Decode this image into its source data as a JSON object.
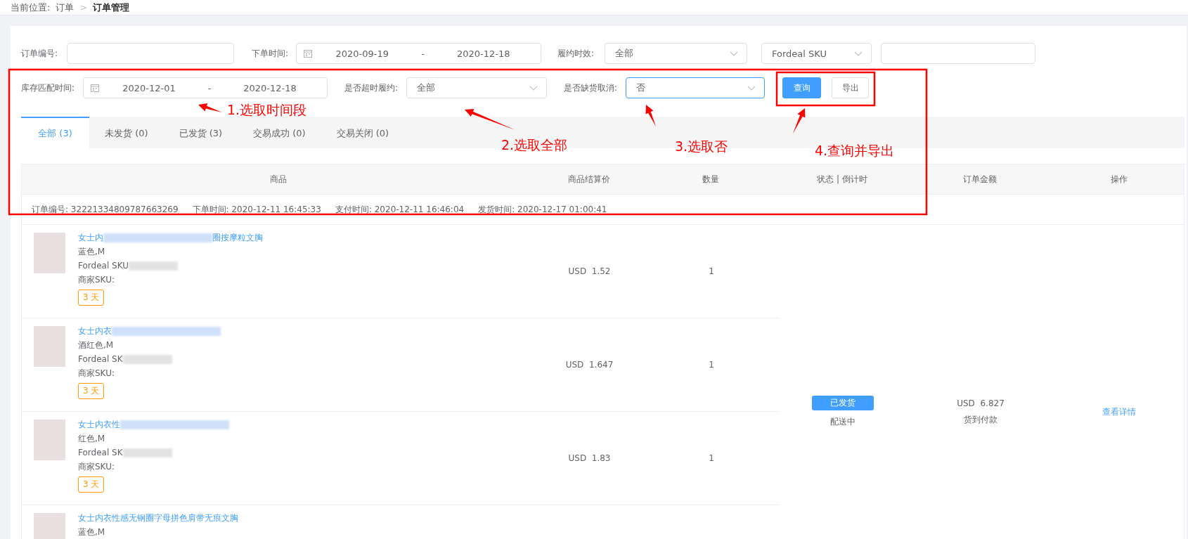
{
  "breadcrumb": {
    "label": "当前位置:",
    "parent": "订单",
    "separator": ">",
    "current": "订单管理"
  },
  "filters_row_1": [
    {
      "kind": "input",
      "label": "订单编号:"
    },
    {
      "kind": "daterange",
      "label": "下单时间:",
      "start": "2020-09-19",
      "separator": "-",
      "end": "2020-12-18"
    },
    {
      "kind": "select",
      "label": "履约时效:",
      "value": "全部"
    },
    {
      "kind": "select",
      "value": "Fordeal SKU"
    },
    {
      "kind": "input"
    }
  ],
  "filters_row_2": [
    {
      "kind": "daterange",
      "label": "库存匹配时间:",
      "start": "2020-12-01",
      "separator": "-",
      "end": "2020-12-18"
    },
    {
      "kind": "select",
      "label": "是否超时履约:",
      "value": "全部",
      "focused": false
    },
    {
      "kind": "select",
      "label": "是否缺货取消:",
      "value": "否",
      "focused": true
    }
  ],
  "buttons": [
    {
      "label": "查询",
      "primary": true
    },
    {
      "label": "导出",
      "primary": false
    }
  ],
  "tabs": [
    {
      "label": "全部 (3)",
      "selected": true
    },
    {
      "label": "未发货 (0)",
      "selected": false
    },
    {
      "label": "已发货 (3)",
      "selected": false
    },
    {
      "label": "交易成功 (0)",
      "selected": false
    },
    {
      "label": "交易关闭 (0)",
      "selected": false
    }
  ],
  "table": {
    "columns": [
      "商品",
      "商品结算价",
      "数量",
      "状态 | 倒计时",
      "订单金额",
      "操作"
    ],
    "order_info": [
      "订单编号: 32221334809787663269",
      "下单时间: 2020-12-11 16:45:33",
      "支付时间: 2020-12-11 16:46:04",
      "发货时间: 2020-12-17 01:00:41"
    ],
    "items": [
      {
        "title_parts": [
          "女士内",
          "圈按摩粒文胸"
        ],
        "title_redacted": true,
        "variant": "蓝色,M",
        "sku": "Fordeal SKU",
        "sku_redacted": true,
        "merchant_sku": "商家SKU:",
        "badge": "3 天",
        "price": "USD  1.52",
        "quantity": "1"
      },
      {
        "title_parts": [
          "女士内衣"
        ],
        "title_redacted": true,
        "variant": "酒红色,M",
        "sku": "Fordeal SK",
        "sku_redacted": true,
        "merchant_sku": "商家SKU:",
        "badge": "3 天",
        "price": "USD  1.647",
        "quantity": "1"
      },
      {
        "title_parts": [
          "女士内衣性"
        ],
        "title_redacted": true,
        "variant": "红色,M",
        "sku": "Fordeal SK",
        "sku_redacted": true,
        "merchant_sku": "商家SKU:",
        "badge": "3 天",
        "price": "USD  1.83",
        "quantity": "1"
      },
      {
        "title_parts": [
          "女士内衣性感无钢圈字母拼色肩带无痕文胸"
        ],
        "title_redacted": false,
        "variant": "蓝色,M"
      }
    ],
    "status": "已发货",
    "status_detail": "配送中",
    "amount": "USD  6.827",
    "payment": "货到付款",
    "action": "查看详情"
  },
  "annotations": [
    "1.选取时间段",
    "2.选取全部",
    "3.选取否",
    "4.查询并导出"
  ]
}
